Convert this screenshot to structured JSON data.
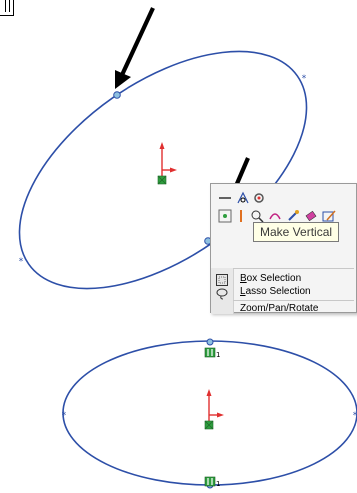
{
  "tooltip": {
    "text": "Make Vertical"
  },
  "menu": {
    "items": [
      {
        "label": "Box Selection",
        "underline": "B",
        "rest": "ox Selection"
      },
      {
        "label": "Lasso Selection",
        "underline": "L",
        "rest": "asso Selection"
      },
      {
        "label": "Zoom/Pan/Rotate"
      }
    ]
  },
  "colors": {
    "sketch": "#2d4fa8",
    "arrow": "#000000",
    "origin_red": "#e03030",
    "relation_green": "#2e9e3e"
  }
}
